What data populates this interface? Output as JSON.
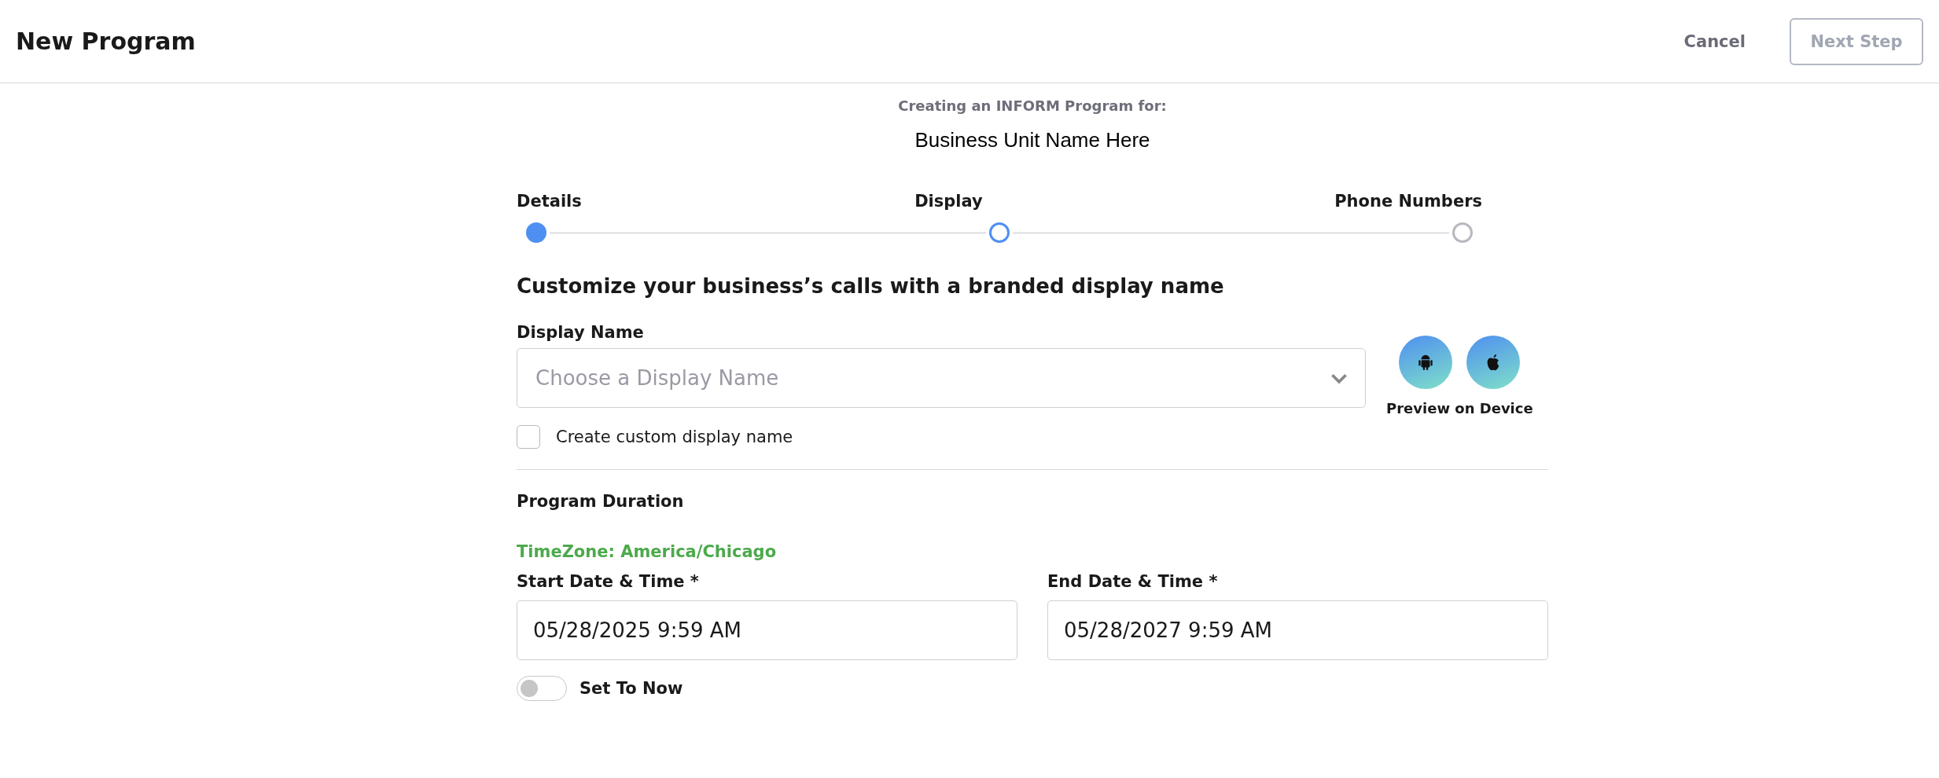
{
  "header": {
    "title": "New Program",
    "cancel": "Cancel",
    "next": {
      "label": "Next Step",
      "disabled": true
    }
  },
  "context": {
    "caption": "Creating an INFORM Program for:",
    "business_unit": "Business Unit Name Here"
  },
  "steps": [
    {
      "label": "Details",
      "completed": true,
      "selected": false
    },
    {
      "label": "Display",
      "completed": false,
      "selected": true
    },
    {
      "label": "Phone Numbers",
      "completed": false,
      "selected": false
    }
  ],
  "heading": "Customize your business’s calls with a branded display name",
  "display_name": {
    "label": "Display Name",
    "placeholder": "Choose a Display Name",
    "preview_label": "Preview on Device"
  },
  "custom_name": {
    "label": "Create custom display name",
    "checked": false
  },
  "duration": {
    "title": "Program Duration",
    "timezone": "TimeZone: America/Chicago",
    "fields": [
      {
        "label": "Start Date & Time *",
        "value": "05/28/2025 9:59 AM"
      },
      {
        "label": "End Date & Time *",
        "value": "05/28/2027 9:59 AM"
      }
    ],
    "set_to_now": {
      "label": "Set To Now",
      "on": false
    }
  }
}
